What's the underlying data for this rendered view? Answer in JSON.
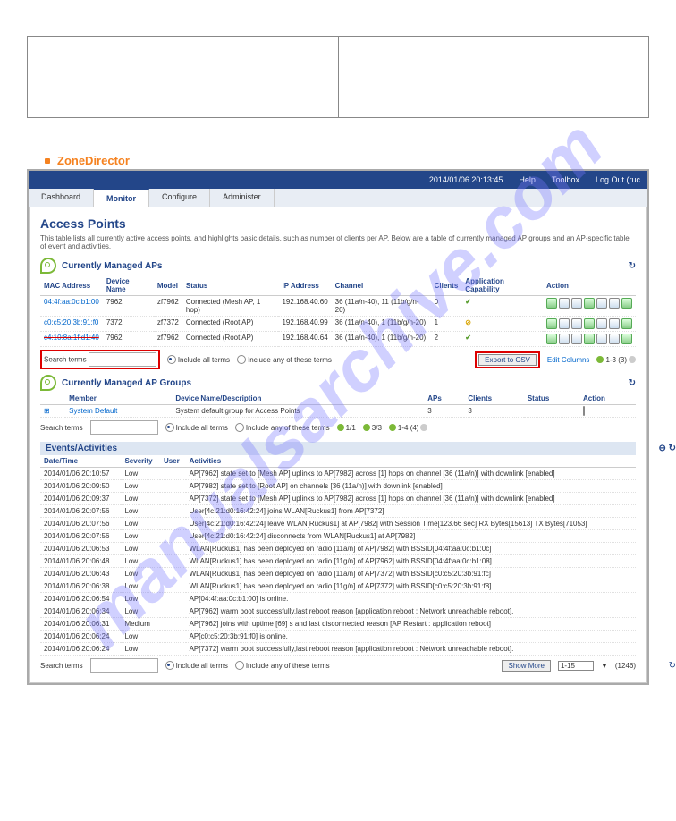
{
  "watermark": "manualsarchive.com",
  "brand": "ZoneDirector",
  "topbar": {
    "datetime": "2014/01/06 20:13:45",
    "help": "Help",
    "toolbox": "Toolbox",
    "logout": "Log Out (ruc"
  },
  "tabs": [
    "Dashboard",
    "Monitor",
    "Configure",
    "Administer"
  ],
  "active_tab": 1,
  "page_title": "Access Points",
  "page_desc": "This table lists all currently active access points, and highlights basic details, such as number of clients per AP. Below are a table of currently managed AP groups and an AP-specific table of event and activities.",
  "aps": {
    "title": "Currently Managed APs",
    "cols": [
      "MAC Address",
      "Device Name",
      "Model",
      "Status",
      "IP Address",
      "Channel",
      "Clients",
      "Application Capability",
      "Action"
    ],
    "rows": [
      {
        "mac": "04:4f:aa:0c:b1:00",
        "name": "7962",
        "model": "zf7962",
        "status": "Connected (Mesh AP, 1 hop)",
        "ip": "192.168.40.60",
        "chan": "36 (11a/n-40), 11 (11b/g/n-20)",
        "clients": "0",
        "cap": "green"
      },
      {
        "mac": "c0:c5:20:3b:91:f0",
        "name": "7372",
        "model": "zf7372",
        "status": "Connected (Root AP)",
        "ip": "192.168.40.99",
        "chan": "36 (11a/n-40), 1 (11b/g/n-20)",
        "clients": "1",
        "cap": "yellow"
      },
      {
        "mac": "c4:10:8a:1f:d1:40",
        "name": "7962",
        "model": "zf7962",
        "status": "Connected (Root AP)",
        "ip": "192.168.40.64",
        "chan": "36 (11a/n-40), 1 (11b/g/n-20)",
        "clients": "2",
        "cap": "green",
        "strike": true
      }
    ],
    "search_label": "Search terms",
    "radio1": "Include all terms",
    "radio2": "Include any of these terms",
    "export": "Export to CSV",
    "edit_cols": "Edit Columns",
    "range": "1-3 (3)"
  },
  "groups": {
    "title": "Currently Managed AP Groups",
    "cols": [
      "",
      "Member",
      "Device Name/Description",
      "APs",
      "Clients",
      "Status",
      "Action"
    ],
    "rows": [
      {
        "member": "System Default",
        "desc": "System default group for Access Points",
        "aps": "3",
        "clients": "3",
        "status": ""
      }
    ],
    "search_label": "Search terms",
    "radio1": "Include all terms",
    "radio2": "Include any of these terms",
    "pg": "1/1",
    "pg2": "3/3",
    "pg3": "1-4 (4)"
  },
  "events": {
    "title": "Events/Activities",
    "cols": [
      "Date/Time",
      "Severity",
      "User",
      "Activities"
    ],
    "rows": [
      {
        "dt": "2014/01/06 20:10:57",
        "sev": "Low",
        "act": "AP[7962] state set to [Mesh AP] uplinks to AP[7982] across [1] hops on channel [36 (11a/n)] with downlink [enabled]"
      },
      {
        "dt": "2014/01/06 20:09:50",
        "sev": "Low",
        "act": "AP[7982] state set to [Root AP] on channels [36 (11a/n)] with downlink [enabled]"
      },
      {
        "dt": "2014/01/06 20:09:37",
        "sev": "Low",
        "act": "AP[7372] state set to [Mesh AP] uplinks to AP[7982] across [1] hops on channel [36 (11a/n)] with downlink [enabled]"
      },
      {
        "dt": "2014/01/06 20:07:56",
        "sev": "Low",
        "act": "User[4c:21:d0:16:42:24] joins WLAN[Ruckus1] from AP[7372]"
      },
      {
        "dt": "2014/01/06 20:07:56",
        "sev": "Low",
        "act": "User[4c:21:d0:16:42:24] leave WLAN[Ruckus1] at AP[7982] with Session Time[123.66 sec] RX Bytes[15613] TX Bytes[71053]"
      },
      {
        "dt": "2014/01/06 20:07:56",
        "sev": "Low",
        "act": "User[4c:21:d0:16:42:24] disconnects from WLAN[Ruckus1] at AP[7982]"
      },
      {
        "dt": "2014/01/06 20:06:53",
        "sev": "Low",
        "act": "WLAN[Ruckus1] has been deployed on radio [11a/n] of AP[7982] with BSSID[04:4f:aa:0c:b1:0c]"
      },
      {
        "dt": "2014/01/06 20:06:48",
        "sev": "Low",
        "act": "WLAN[Ruckus1] has been deployed on radio [11g/n] of AP[7962] with BSSID[04:4f:aa:0c:b1:08]"
      },
      {
        "dt": "2014/01/06 20:06:43",
        "sev": "Low",
        "act": "WLAN[Ruckus1] has been deployed on radio [11a/n] of AP[7372] with BSSID[c0:c5:20:3b:91:fc]"
      },
      {
        "dt": "2014/01/06 20:06:38",
        "sev": "Low",
        "act": "WLAN[Ruckus1] has been deployed on radio [11g/n] of AP[7372] with BSSID[c0:c5:20:3b:91:f8]"
      },
      {
        "dt": "2014/01/06 20:06:54",
        "sev": "Low",
        "act": "AP[04:4f:aa:0c:b1:00] is online."
      },
      {
        "dt": "2014/01/06 20:06:34",
        "sev": "Low",
        "act": "AP[7962] warm boot successfully,last reboot reason [application reboot : Network unreachable reboot]."
      },
      {
        "dt": "2014/01/06 20:06:31",
        "sev": "Medium",
        "act": "AP[7962] joins with uptime [69] s and last disconnected reason [AP Restart : application reboot]"
      },
      {
        "dt": "2014/01/06 20:06:24",
        "sev": "Low",
        "act": "AP[c0:c5:20:3b:91:f0] is online."
      },
      {
        "dt": "2014/01/06 20:06:24",
        "sev": "Low",
        "act": "AP[7372] warm boot successfully,last reboot reason [application reboot : Network unreachable reboot]."
      }
    ],
    "search_label": "Search terms",
    "radio1": "Include all terms",
    "radio2": "Include any of these terms",
    "show_more": "Show More",
    "range": "1-15",
    "total": "(1246)"
  }
}
